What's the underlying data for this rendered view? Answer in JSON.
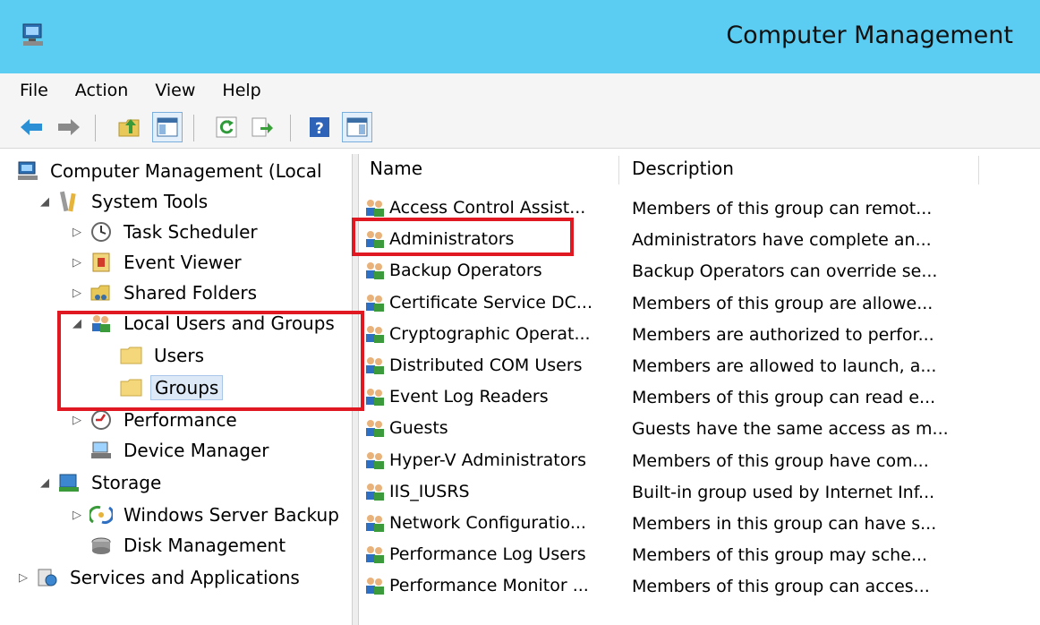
{
  "window": {
    "title": "Computer Management"
  },
  "menu": [
    "File",
    "Action",
    "View",
    "Help"
  ],
  "toolbar": {
    "icons": [
      "back-arrow-icon",
      "forward-arrow-icon",
      "up-folder-icon",
      "show-hide-console-tree-icon",
      "refresh-icon",
      "export-list-icon",
      "help-icon",
      "show-hide-action-pane-icon"
    ]
  },
  "tree": {
    "root": "Computer Management (Local",
    "system_tools": "System Tools",
    "task_scheduler": "Task Scheduler",
    "event_viewer": "Event Viewer",
    "shared_folders": "Shared Folders",
    "local_users_groups": "Local Users and Groups",
    "users": "Users",
    "groups": "Groups",
    "performance": "Performance",
    "device_manager": "Device Manager",
    "storage": "Storage",
    "windows_server_backup": "Windows Server Backup",
    "disk_management": "Disk Management",
    "services_apps": "Services and Applications"
  },
  "list": {
    "columns": {
      "name": "Name",
      "description": "Description"
    },
    "rows": [
      {
        "name": "Access Control Assist...",
        "description": "Members of this group can remot..."
      },
      {
        "name": "Administrators",
        "description": "Administrators have complete an..."
      },
      {
        "name": "Backup Operators",
        "description": "Backup Operators can override se..."
      },
      {
        "name": "Certificate Service DC...",
        "description": "Members of this group are allowe..."
      },
      {
        "name": "Cryptographic Operat...",
        "description": "Members are authorized to perfor..."
      },
      {
        "name": "Distributed COM Users",
        "description": "Members are allowed to launch, a..."
      },
      {
        "name": "Event Log Readers",
        "description": "Members of this group can read e..."
      },
      {
        "name": "Guests",
        "description": "Guests have the same access as m..."
      },
      {
        "name": "Hyper-V Administrators",
        "description": "Members of this group have com..."
      },
      {
        "name": "IIS_IUSRS",
        "description": "Built-in group used by Internet Inf..."
      },
      {
        "name": "Network Configuratio...",
        "description": "Members in this group can have s..."
      },
      {
        "name": "Performance Log Users",
        "description": "Members of this group may sche..."
      },
      {
        "name": "Performance Monitor ...",
        "description": "Members of this group can acces..."
      }
    ]
  },
  "colors": {
    "titlebar": "#5bcdf2",
    "highlight": "#e01822",
    "selection": "#dde9f6"
  }
}
